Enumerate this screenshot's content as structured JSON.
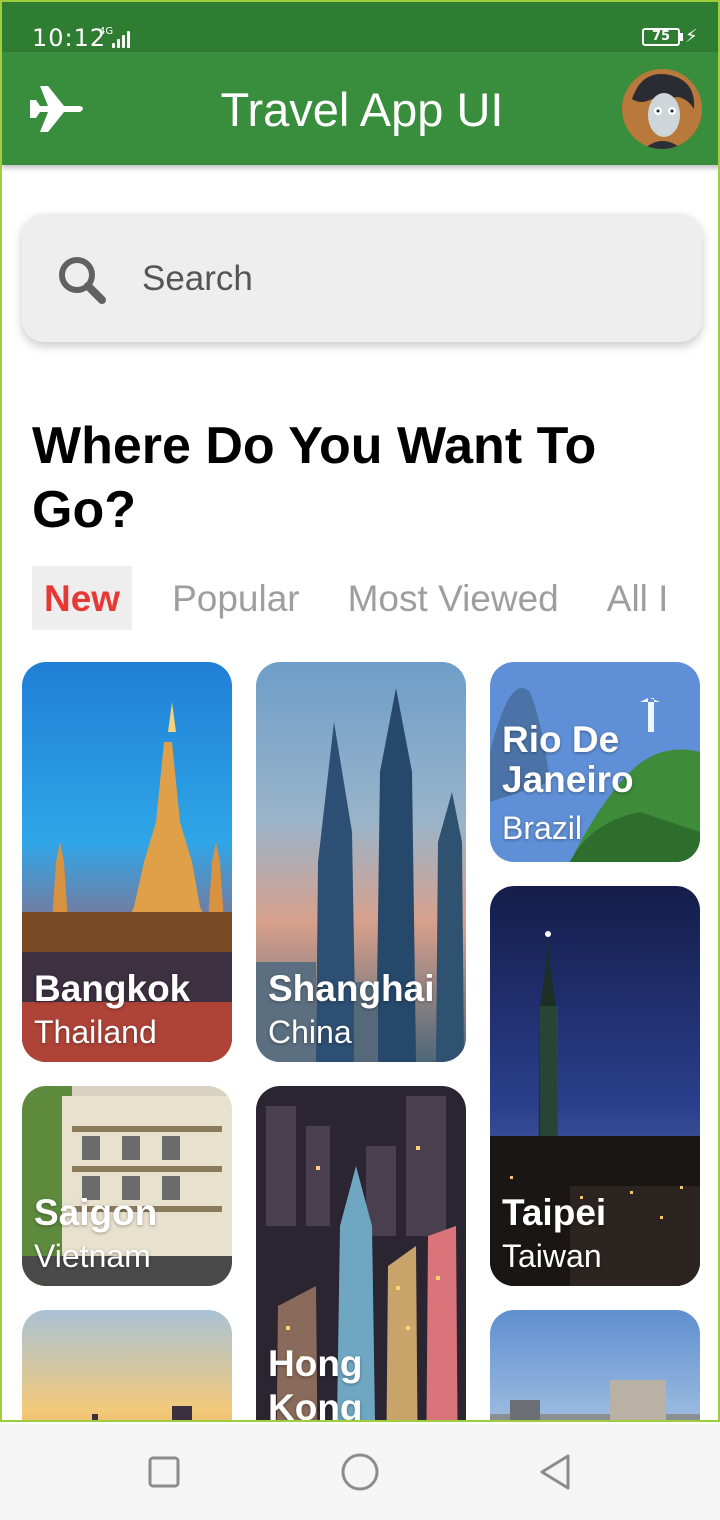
{
  "status_bar": {
    "time": "10:12",
    "network": "4G",
    "battery": "75"
  },
  "app_bar": {
    "title": "Travel App UI",
    "leading_icon": "airplane-icon",
    "avatar": "user-avatar"
  },
  "search": {
    "placeholder": "Search",
    "icon": "search-icon"
  },
  "heading": "Where Do You Want To Go?",
  "tabs": [
    {
      "label": "New",
      "active": true
    },
    {
      "label": "Popular",
      "active": false
    },
    {
      "label": "Most Viewed",
      "active": false
    },
    {
      "label": "All I",
      "active": false
    }
  ],
  "destinations": [
    {
      "name": "Bangkok",
      "country": "Thailand"
    },
    {
      "name": "Shanghai",
      "country": "China"
    },
    {
      "name": "Rio De Janeiro",
      "country": "Brazil"
    },
    {
      "name": "Saigon",
      "country": "Vietnam"
    },
    {
      "name": "Hong Kong",
      "country": ""
    },
    {
      "name": "Taipei",
      "country": "Taiwan"
    }
  ],
  "colors": {
    "primary": "#388e3c",
    "status_bar": "#2e7d32",
    "accent": "#e53935",
    "inactive_tab": "#9e9e9e"
  },
  "nav_bar": {
    "recent": "square-icon",
    "home": "circle-icon",
    "back": "triangle-back-icon"
  }
}
